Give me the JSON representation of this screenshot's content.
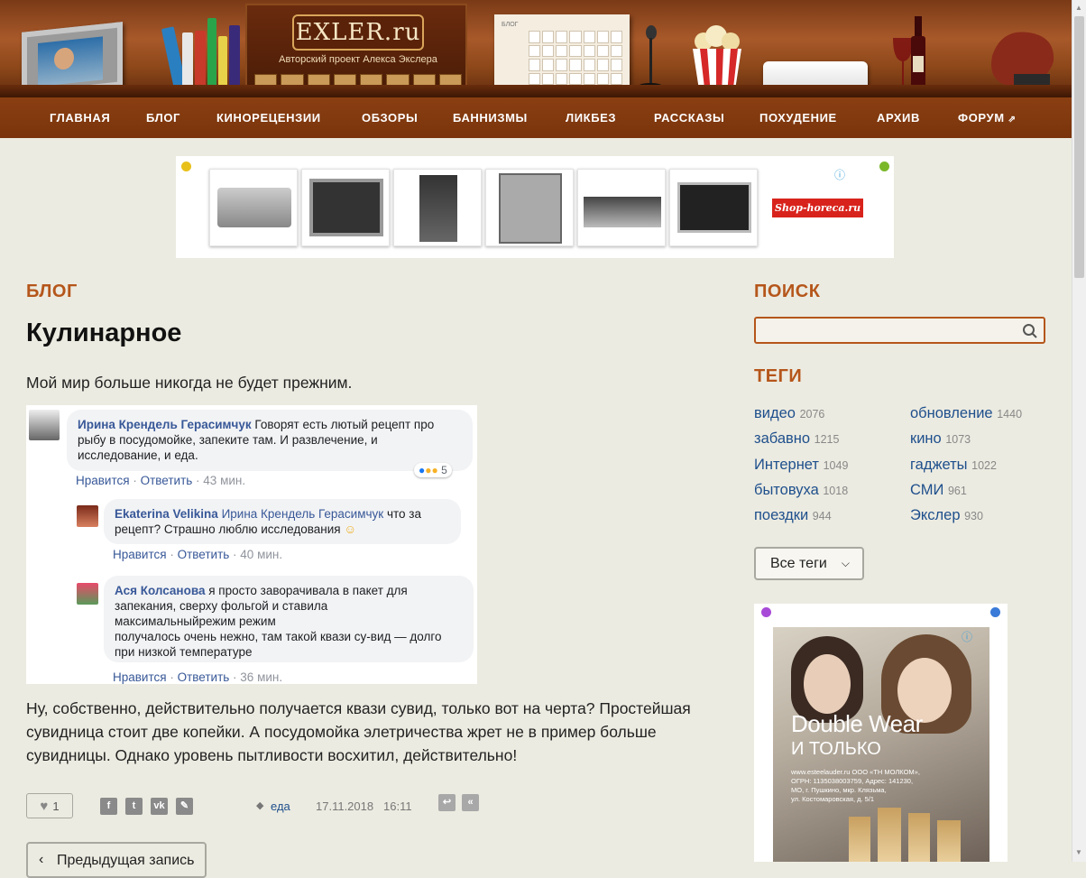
{
  "header": {
    "logo": "EXLER.ru",
    "subtitle": "Авторский проект Алекса Экслера",
    "calendar_label": "БЛОГ"
  },
  "nav": {
    "items": [
      {
        "label": "ГЛАВНАЯ"
      },
      {
        "label": "БЛОГ"
      },
      {
        "label": "КИНОРЕЦЕНЗИИ"
      },
      {
        "label": "ОБЗОРЫ"
      },
      {
        "label": "БАННИЗМЫ"
      },
      {
        "label": "ЛИКБЕЗ"
      },
      {
        "label": "РАССКАЗЫ"
      },
      {
        "label": "ПОХУДЕНИЕ"
      },
      {
        "label": "АРХИВ"
      },
      {
        "label": "ФОРУМ"
      }
    ]
  },
  "ad_top": {
    "brand": "Shop-horeca.ru",
    "info_icon": "info-icon"
  },
  "post": {
    "section": "БЛОГ",
    "title": "Кулинарное",
    "intro": "Мой мир больше никогда не будет прежним.",
    "body": "Ну, собственно, действительно получается квази сувид, только вот на черта? Простейшая сувидница стоит две копейки. А посудомойка элетричества жрет не в пример больше сувидницы. Однако уровень пытливости восхитил, действительно!",
    "likes": "1",
    "tag": "еда",
    "date": "17.11.2018",
    "time": "16:11",
    "prev_label": "Предыдущая запись"
  },
  "fb": {
    "c1": {
      "name": "Ирина Крендель Герасимчук",
      "text": "Говорят есть лютый рецепт про рыбу в посудомойке, запеките там. И развлечение, и исследование, и еда.",
      "like": "Нравится",
      "reply": "Ответить",
      "time": "43 мин.",
      "reactions": "5"
    },
    "c2": {
      "name": "Ekaterina Velikina",
      "ref": "Ирина Крендель Герасимчук",
      "text1": "что за",
      "text2": "рецепт? Страшно люблю исследования",
      "like": "Нравится",
      "reply": "Ответить",
      "time": "40 мин."
    },
    "c3": {
      "name": "Ася Колсанова",
      "text1": "я просто заворачивала в пакет для",
      "line2": "запекания, сверху фольгой и ставила",
      "line3": "максимальныйрежим режим",
      "line4": "получалось очень нежно, там такой квази су-вид — долго",
      "line5": "при низкой температуре",
      "like": "Нравится",
      "reply": "Ответить",
      "time": "36 мин."
    }
  },
  "sidebar": {
    "search_title": "ПОИСК",
    "tags_title": "ТЕГИ",
    "tags_left": [
      {
        "name": "видео",
        "count": "2076"
      },
      {
        "name": "забавно",
        "count": "1215"
      },
      {
        "name": "Интернет",
        "count": "1049"
      },
      {
        "name": "бытовуха",
        "count": "1018"
      },
      {
        "name": "поездки",
        "count": "944"
      }
    ],
    "tags_right": [
      {
        "name": "обновление",
        "count": "1440"
      },
      {
        "name": "кино",
        "count": "1073"
      },
      {
        "name": "гаджеты",
        "count": "1022"
      },
      {
        "name": "СМИ",
        "count": "961"
      },
      {
        "name": "Экслер",
        "count": "930"
      }
    ],
    "all_tags": "Все теги",
    "ad": {
      "headline1": "Double Wear",
      "headline2": "И ТОЛЬКО",
      "fine1": "www.esteelauder.ru ООО «ТН МОЛКОМ»,",
      "fine2": "ОГРН: 1135038003759, Адрес: 141230,",
      "fine3": "МО, г. Пушкино, мкр. Клязьма,",
      "fine4": "ул. Костомаровская, д. 5/1"
    }
  },
  "colors": {
    "accent": "#b5561b",
    "nav_bg": "#8a3f12",
    "link": "#1e4f8c",
    "page_bg": "#ecebe1"
  }
}
